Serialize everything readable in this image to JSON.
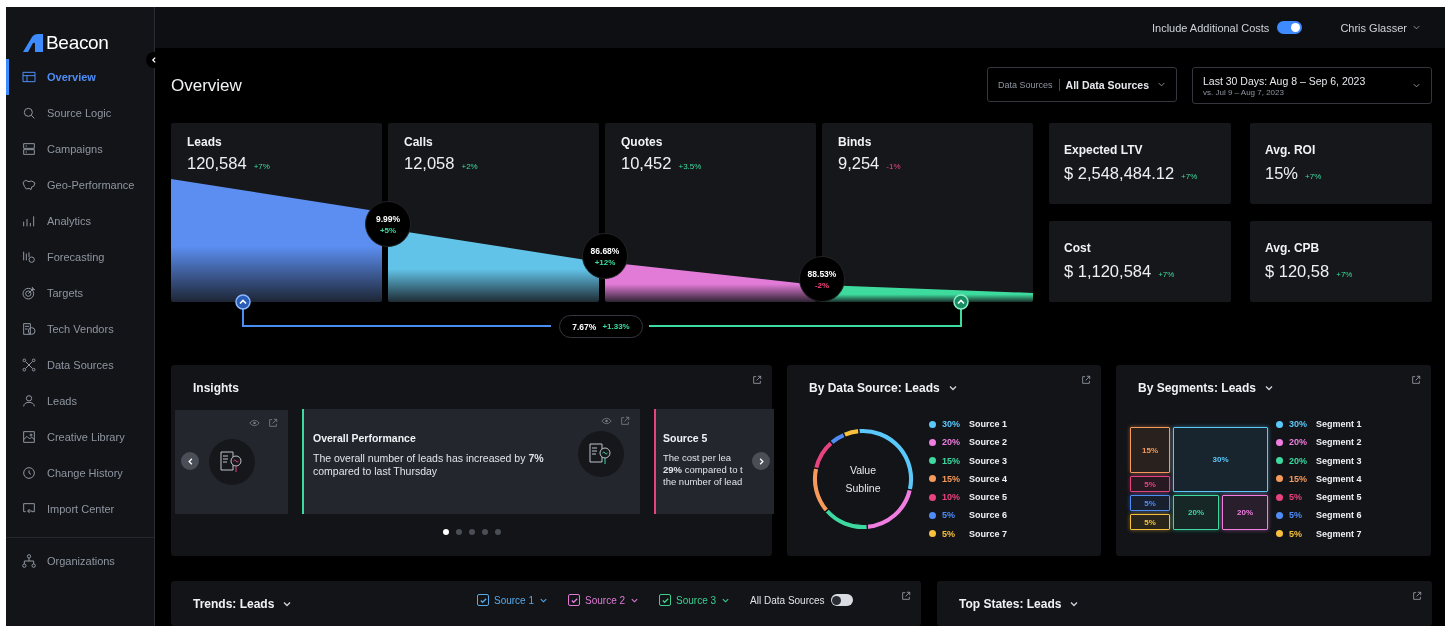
{
  "topbar": {
    "toggle_label": "Include Additional Costs",
    "include_costs": true,
    "user": "Chris Glasser"
  },
  "sidebar": {
    "logo": "Beacon",
    "items": [
      {
        "label": "Overview",
        "selected": true
      },
      {
        "label": "Source Logic",
        "selected": false
      },
      {
        "label": "Campaigns",
        "selected": false
      },
      {
        "label": "Geo-Performance",
        "selected": false
      },
      {
        "label": "Analytics",
        "selected": false
      },
      {
        "label": "Forecasting",
        "selected": false
      },
      {
        "label": "Targets",
        "selected": false
      },
      {
        "label": "Tech Vendors",
        "selected": false
      },
      {
        "label": "Data Sources",
        "selected": false
      },
      {
        "label": "Leads",
        "selected": false
      },
      {
        "label": "Creative Library",
        "selected": false
      },
      {
        "label": "Change History",
        "selected": false
      },
      {
        "label": "Import Center",
        "selected": false
      }
    ],
    "bottom_items": [
      {
        "label": "Organizations",
        "selected": false
      }
    ]
  },
  "page_title": "Overview",
  "filters": {
    "data_sources_label": "Data Sources",
    "data_sources_value": "All Data Sources",
    "date_range": "Last 30 Days: Aug 8 – Sep 6, 2023",
    "comparison": "vs. Jul 9 – Aug 7, 2023"
  },
  "funnel": {
    "stages": [
      {
        "label": "Leads",
        "value": "120,584",
        "change": "+7%",
        "negative": false,
        "color": "#5b8ef0"
      },
      {
        "label": "Calls",
        "value": "12,058",
        "change": "+2%",
        "negative": false,
        "color": "#62c3e8"
      },
      {
        "label": "Quotes",
        "value": "10,452",
        "change": "+3.5%",
        "negative": false,
        "color": "#e27bd8"
      },
      {
        "label": "Binds",
        "value": "9,254",
        "change": "-1%",
        "negative": true,
        "color": "#3ddc9e"
      }
    ],
    "conversions": [
      {
        "rate": "9.99%",
        "change": "+5%",
        "negative": false
      },
      {
        "rate": "86.68%",
        "change": "+12%",
        "negative": false
      },
      {
        "rate": "88.53%",
        "change": "-2%",
        "negative": true
      }
    ],
    "overall": {
      "rate": "7.67%",
      "change": "+1.33%",
      "negative": false
    }
  },
  "kpis": [
    {
      "label": "Expected LTV",
      "value": "$ 2,548,484.12",
      "change": "+7%",
      "negative": false
    },
    {
      "label": "Avg. ROI",
      "value": "15%",
      "change": "+7%",
      "negative": false
    },
    {
      "label": "Cost",
      "value": "$ 1,120,584",
      "change": "+7%",
      "negative": false
    },
    {
      "label": "Avg. CPB",
      "value": "$ 120,58",
      "change": "+7%",
      "negative": false
    }
  ],
  "insights": {
    "title": "Insights",
    "cards": [
      {
        "kind": "icons"
      },
      {
        "kind": "full",
        "title": "Overall Performance",
        "text": "The overall number of leads has increased by **7%** compared to last Thursday",
        "color": "#3dd9a0"
      },
      {
        "kind": "cut",
        "title": "Source 5",
        "lines": [
          "The cost per lea",
          "**29%** compared to t",
          "the number of lead"
        ],
        "color": "#e8427f"
      }
    ],
    "pages": [
      {
        "selected": true
      },
      {
        "selected": false
      },
      {
        "selected": false
      },
      {
        "selected": false
      },
      {
        "selected": false
      }
    ]
  },
  "by_source": {
    "title": "By Data Source: Leads",
    "center_value": "Value",
    "center_subline": "Subline",
    "legend": [
      {
        "pct": "30%",
        "color": "#5ac8fa"
      },
      {
        "pct": "20%",
        "color": "#f07ee0"
      },
      {
        "pct": "15%",
        "color": "#3dd9a0"
      },
      {
        "pct": "15%",
        "color": "#f59a5b"
      },
      {
        "pct": "10%",
        "color": "#e8427f"
      },
      {
        "pct": "5%",
        "color": "#4f8cf7"
      },
      {
        "pct": "5%",
        "color": "#f8c03c"
      }
    ],
    "chart_data": {
      "type": "donut",
      "categories": [
        "Source 1",
        "Source 2",
        "Source 3",
        "Source 4",
        "Source 5",
        "Source 6",
        "Source 7"
      ],
      "values": [
        30,
        20,
        15,
        15,
        10,
        5,
        5
      ]
    }
  },
  "by_segment": {
    "title": "By Segments: Leads",
    "tiles": [
      {
        "label": "15%",
        "color": "#f59a5b"
      },
      {
        "label": "30%",
        "color": "#5ac8fa"
      },
      {
        "label": "5%",
        "color": "#e8427f"
      },
      {
        "label": "5%",
        "color": "#4f8cf7"
      },
      {
        "label": "5%",
        "color": "#f8c03c"
      },
      {
        "label": "20%",
        "color": "#3dd9a0"
      },
      {
        "label": "20%",
        "color": "#f07ee0"
      }
    ],
    "legend": [
      {
        "pct": "30%",
        "label": "Segment 1",
        "color": "#5ac8fa"
      },
      {
        "pct": "20%",
        "label": "Segment 2",
        "color": "#f07ee0"
      },
      {
        "pct": "20%",
        "label": "Segment 3",
        "color": "#3dd9a0"
      },
      {
        "pct": "15%",
        "label": "Segment 4",
        "color": "#f59a5b"
      },
      {
        "pct": "5%",
        "label": "Segment 5",
        "color": "#e8427f"
      },
      {
        "pct": "5%",
        "label": "Segment 6",
        "color": "#4f8cf7"
      },
      {
        "pct": "5%",
        "label": "Segment 7",
        "color": "#f8c03c"
      }
    ]
  },
  "trends": {
    "title": "Trends: Leads",
    "sources": [
      {
        "label": "Source 1",
        "checked": true,
        "color": "#5aa9e6"
      },
      {
        "label": "Source 2",
        "checked": true,
        "color": "#e07ad6"
      },
      {
        "label": "Source 3",
        "checked": true,
        "color": "#3ecf8e"
      }
    ],
    "all_sources_label": "All Data Sources",
    "all_sources_on": false
  },
  "top_states": {
    "title": "Top States: Leads"
  }
}
